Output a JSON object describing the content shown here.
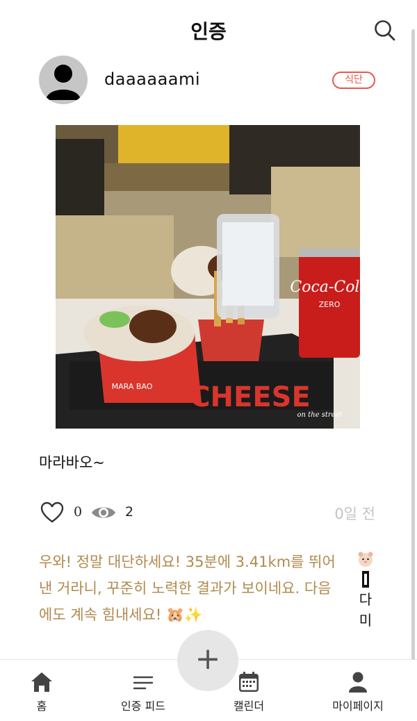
{
  "header": {
    "title": "인증"
  },
  "post": {
    "username": "daaaaaami",
    "category": "식단",
    "caption": "마라바오~",
    "like_count": "0",
    "view_count": "2",
    "date": "0일 전",
    "photo_brand_texts": [
      "Coca-Cola",
      "ZERO",
      "MARA BAO",
      "CHEESE",
      "on the street"
    ]
  },
  "comment": {
    "text": "우와! 정말 대단하세요! 35분에 3.41km를 뛰어낸 거라니, 꾸준히 노력한 결과가 보이네요. 다음에도 계속 힘내세요! 🐹✨",
    "author_name": "다미"
  },
  "fab": {
    "label": "+"
  },
  "tabs": [
    {
      "label": "홈",
      "icon": "home-icon"
    },
    {
      "label": "인증 피드",
      "icon": "feed-icon"
    },
    {
      "label": "캘린더",
      "icon": "calendar-icon"
    },
    {
      "label": "마이페이지",
      "icon": "person-icon"
    }
  ],
  "colors": {
    "badge": "#e8584d",
    "comment_text": "#b08a4e",
    "date_text": "#c4c4c4",
    "fab_bg": "#e6e6e6",
    "icon_dark": "#444444"
  }
}
